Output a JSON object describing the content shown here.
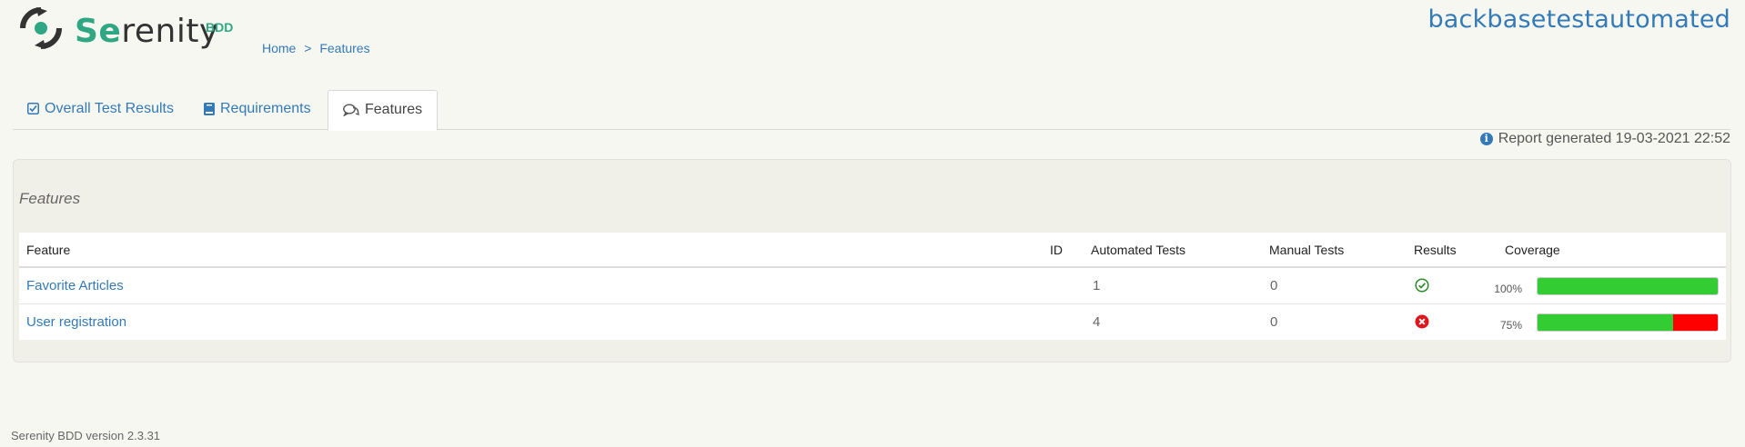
{
  "header": {
    "logo_main": "renity",
    "logo_prefix": "Se",
    "logo_suffix": "BDD",
    "project": "backbasetestautomated",
    "breadcrumb": [
      {
        "label": "Home"
      },
      {
        "label": "Features"
      }
    ],
    "breadcrumb_separator": ">"
  },
  "tabs": [
    {
      "label": "Overall Test Results",
      "icon": "checkbox-icon",
      "active": false
    },
    {
      "label": "Requirements",
      "icon": "book-icon",
      "active": false
    },
    {
      "label": "Features",
      "icon": "comments-icon",
      "active": true
    }
  ],
  "report_generated": "Report generated 19-03-2021 22:52",
  "panel": {
    "title": "Features",
    "columns": [
      "Feature",
      "ID",
      "Automated Tests",
      "Manual Tests",
      "Results",
      "Coverage"
    ],
    "rows": [
      {
        "feature": "Favorite Articles",
        "id": "",
        "automated": "1",
        "manual": "0",
        "result": "success",
        "result_icon": "check-circle-icon",
        "coverage_label": "100%",
        "coverage": 100
      },
      {
        "feature": "User registration",
        "id": "",
        "automated": "4",
        "manual": "0",
        "result": "failure",
        "result_icon": "error-circle-icon",
        "coverage_label": "75%",
        "coverage": 75
      }
    ]
  },
  "colors": {
    "accent": "#337ab7",
    "brand": "#2fa783",
    "pass": "#33cc33",
    "fail": "#ff0000"
  },
  "footer": "Serenity BDD version 2.3.31"
}
